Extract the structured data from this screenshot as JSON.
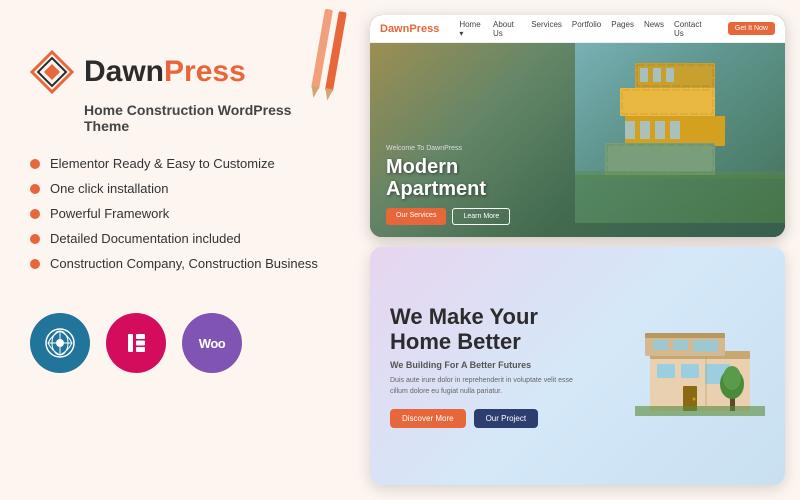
{
  "left": {
    "logo": {
      "dawn": "Dawn",
      "press": "Press"
    },
    "tagline": "Home Construction WordPress Theme",
    "features": [
      "Elementor Ready & Easy to Customize",
      "One click installation",
      "Powerful Framework",
      "Detailed Documentation included",
      "Construction Company, Construction Business"
    ],
    "badges": {
      "wp_label": "WP",
      "el_label": "E",
      "woo_label": "Woo"
    }
  },
  "right": {
    "top_screen": {
      "brand_dawn": "Dawn",
      "brand_press": "Press",
      "nav_items": [
        "Home",
        "About Us",
        "Services",
        "Portfolio",
        "Pages",
        "News",
        "Contact Us"
      ],
      "cta_button": "Get It Now",
      "hero_welcome": "Welcome To DawnPress",
      "hero_title_line1": "Modern",
      "hero_title_line2": "Apartment",
      "hero_btn1": "Our Services",
      "hero_btn2": "Learn More"
    },
    "bottom_screen": {
      "title_line1": "We Make Your",
      "title_line2": "Home Better",
      "subtitle": "We Building For A Better Futures",
      "description": "Duis aute irure dolor in reprehenderit in voluptate velit esse cillum dolore eu fugiat nulla pariatur.",
      "btn1": "Discover More",
      "btn2": "Our Project"
    }
  }
}
